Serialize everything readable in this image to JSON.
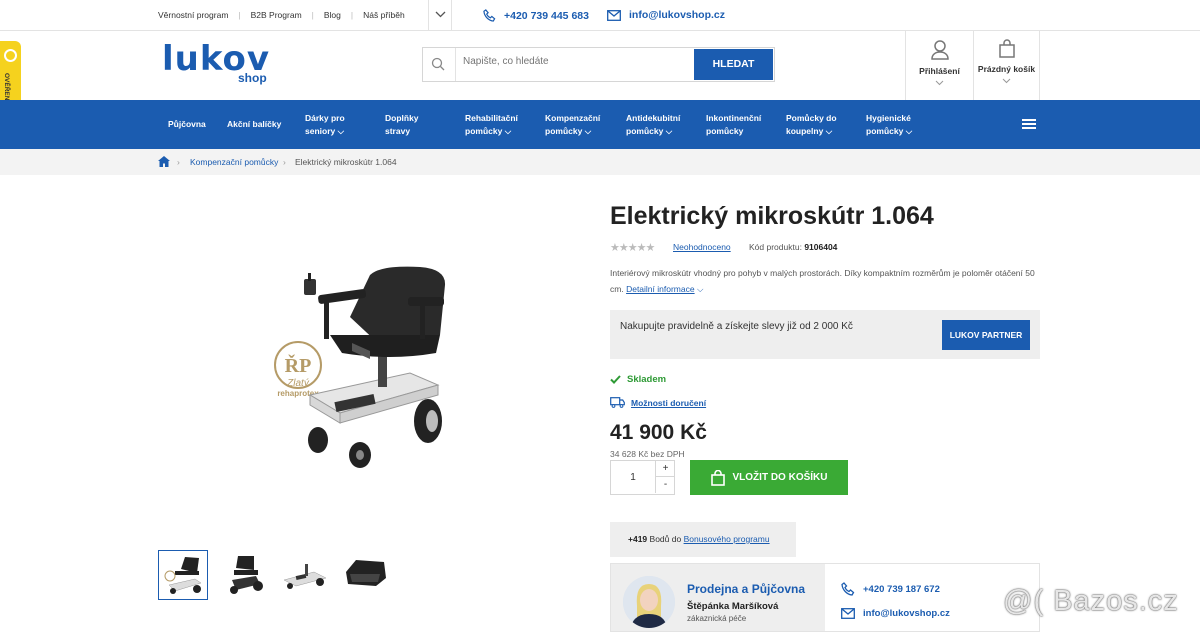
{
  "top": {
    "links": [
      "Věrnostní program",
      "B2B Program",
      "Blog",
      "Náš příběh"
    ],
    "phone": "+420 739 445 683",
    "email": "info@lukovshop.cz"
  },
  "logo": {
    "main": "lukov",
    "sub": "shop"
  },
  "search": {
    "placeholder": "Napište, co hledáte",
    "button": "HLEDAT"
  },
  "account": {
    "login": "Přihlášení",
    "cart": "Prázdný košík"
  },
  "nav": [
    {
      "l1": "Půjčovna",
      "l2": ""
    },
    {
      "l1": "Akční balíčky",
      "l2": ""
    },
    {
      "l1": "Dárky pro",
      "l2": "seniory"
    },
    {
      "l1": "Doplňky",
      "l2": "stravy"
    },
    {
      "l1": "Rehabilitační",
      "l2": "pomůcky"
    },
    {
      "l1": "Kompenzační",
      "l2": "pomůcky"
    },
    {
      "l1": "Antidekubitní",
      "l2": "pomůcky"
    },
    {
      "l1": "Inkontinenční",
      "l2": "pomůcky"
    },
    {
      "l1": "Pomůcky do",
      "l2": "koupelny"
    },
    {
      "l1": "Hygienické",
      "l2": "pomůcky"
    }
  ],
  "breadcrumb": {
    "category": "Kompenzační pomůcky",
    "current": "Elektrický mikroskútr 1.064"
  },
  "badge": {
    "text": "OVĚŘENO ZÁKAZNÍKY"
  },
  "image_logo": {
    "line1": "Zlatý",
    "line2": "rehaprotex"
  },
  "product": {
    "title": "Elektrický mikroskútr 1.064",
    "rating_text": "Neohodnoceno",
    "code_label": "Kód produktu:",
    "code": "9106404",
    "description": "Interiérový mikroskútr vhodný pro pohyb v malých prostorách. Díky kompaktním rozměrům je poloměr otáčení 50 cm.",
    "details_link": "Detailní informace",
    "partner_text": "Nakupujte pravidelně a získejte slevy již od 2 000 Kč",
    "partner_button": "LUKOV PARTNER",
    "stock": "Skladem",
    "delivery": "Možnosti doručení",
    "price": "41 900 Kč",
    "price_net": "34 628 Kč bez DPH",
    "quantity": "1",
    "qty_plus": "+",
    "qty_minus": "-",
    "cart_button": "VLOŽIT DO KOŠÍKU",
    "bonus_points": "+419",
    "bonus_text": "Bodů do",
    "bonus_link": "Bonusového programu"
  },
  "store": {
    "title": "Prodejna a Půjčovna",
    "name": "Štěpánka Maršíková",
    "role": "zákaznická péče",
    "phone": "+420 739 187 672",
    "email": "info@lukovshop.cz"
  },
  "watermark": "@( Bazos.cz",
  "colors": {
    "brand": "#1b5cb0",
    "cta": "#3aaa35",
    "stock": "#2e9a35",
    "badge": "#f5d21e"
  }
}
